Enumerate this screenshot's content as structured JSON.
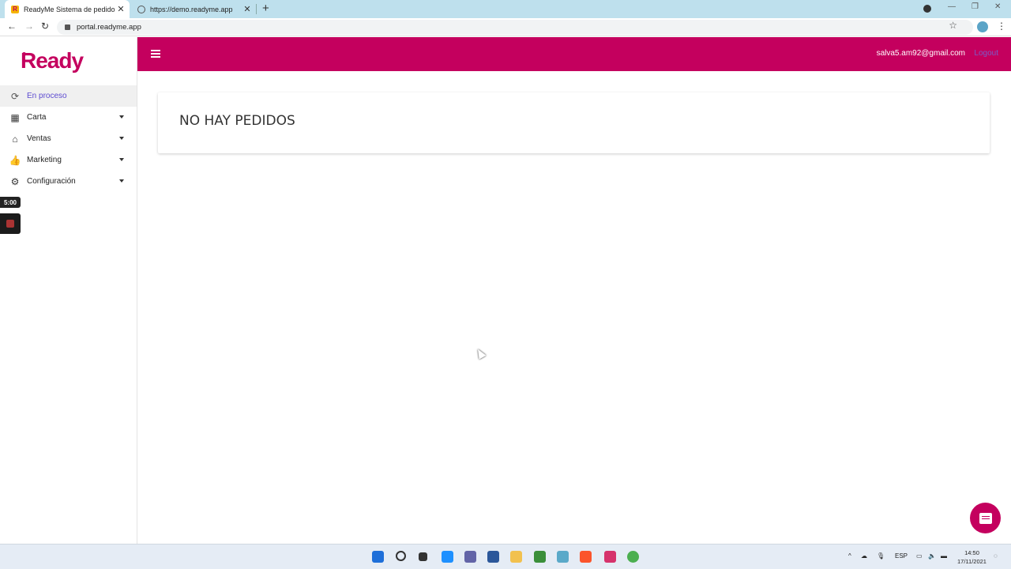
{
  "browser": {
    "tabs": [
      {
        "title": "ReadyMe Sistema de pedidos",
        "active": true
      },
      {
        "title": "https://demo.readyme.app",
        "active": false
      }
    ],
    "url": "portal.readyme.app"
  },
  "app": {
    "logo_text": "Ready",
    "brand_color": "#c4005e",
    "accent_color": "#5d4bd1"
  },
  "sidebar": {
    "items": [
      {
        "label": "En proceso",
        "icon": "process-icon",
        "active": true
      },
      {
        "label": "Carta",
        "icon": "dashboard-icon",
        "expandable": true
      },
      {
        "label": "Ventas",
        "icon": "store-icon",
        "expandable": true
      },
      {
        "label": "Marketing",
        "icon": "thumb-up-icon",
        "expandable": true
      },
      {
        "label": "Configuración",
        "icon": "gear-icon",
        "expandable": true
      }
    ],
    "timer": "5:00"
  },
  "header": {
    "user_email": "salva5.am92@gmail.com",
    "logout_label": "Logout"
  },
  "main": {
    "empty_message": "NO HAY PEDIDOS"
  },
  "taskbar": {
    "language": "ESP",
    "time": "14:50",
    "date": "17/11/2021"
  }
}
